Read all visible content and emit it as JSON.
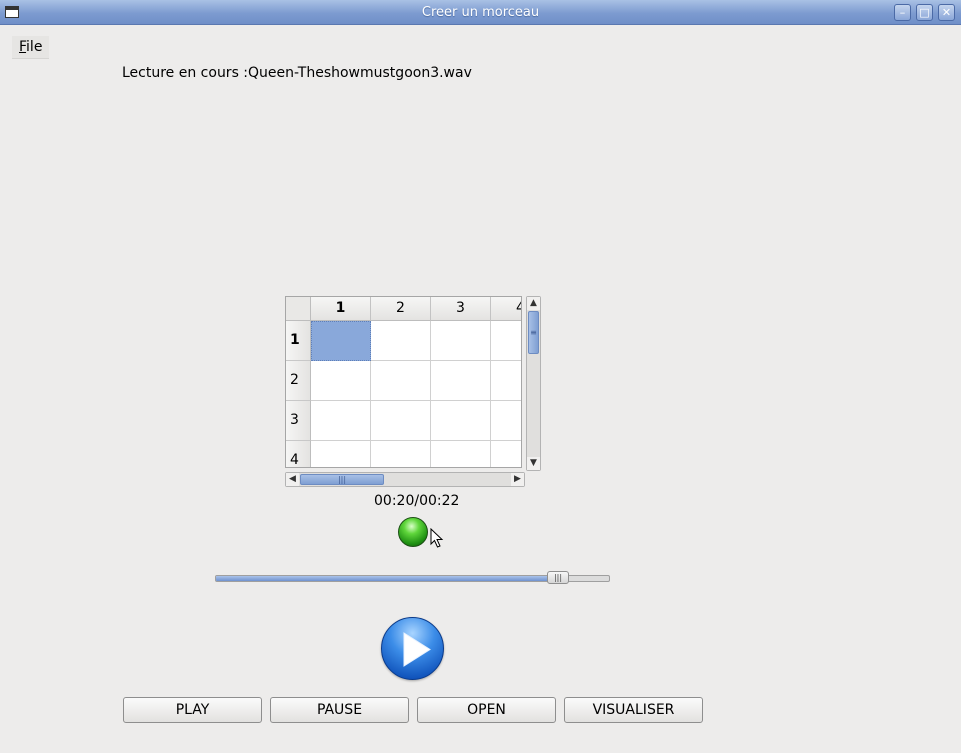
{
  "window": {
    "title": "Creer un morceau",
    "controls": [
      "minimize-icon",
      "maximize-icon",
      "close-icon"
    ]
  },
  "menu": {
    "file_label_underlined": "F",
    "file_label_rest": "ile"
  },
  "status": {
    "now_playing": "Lecture en cours :Queen-Theshowmustgoon3.wav"
  },
  "table": {
    "column_headers": [
      "1",
      "2",
      "3",
      "4"
    ],
    "row_headers": [
      "1",
      "2",
      "3",
      "4"
    ],
    "selected_cell": {
      "row": 1,
      "column": 1
    }
  },
  "playback": {
    "time": "00:20/00:22",
    "position_fraction": 0.89,
    "indicator_color": "#3cc41e"
  },
  "buttons": {
    "play": "PLAY",
    "pause": "PAUSE",
    "open": "OPEN",
    "visualiser": "VISUALISER"
  },
  "colors": {
    "titlebar": "#7d9bd0",
    "selection": "#89a8da",
    "accent": "#2f7fe0"
  }
}
